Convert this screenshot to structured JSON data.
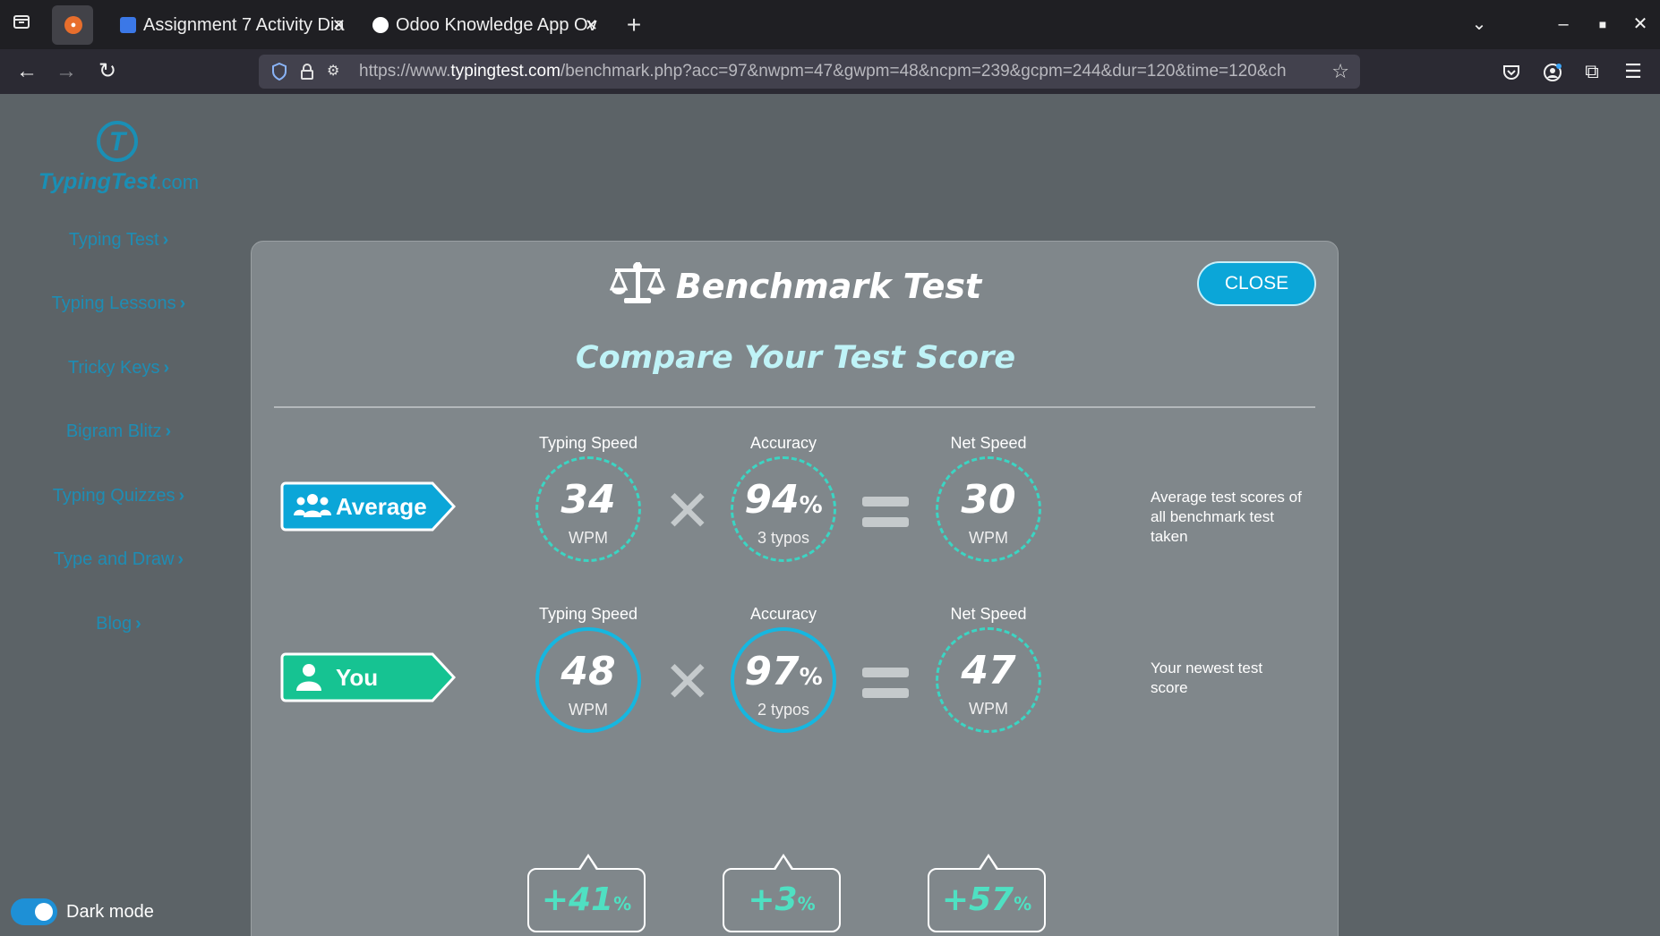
{
  "browser": {
    "tabs": [
      {
        "title": "Assignment 7 Activity Dia"
      },
      {
        "title": "Odoo Knowledge App Ov"
      }
    ],
    "url_prefix": "https://www.",
    "url_host": "typingtest.com",
    "url_rest": "/benchmark.php?acc=97&nwpm=47&gwpm=48&ncpm=239&gcpm=244&dur=120&time=120&ch"
  },
  "sidebar": {
    "logo_main": "TypingTest",
    "logo_suffix": ".com",
    "links": [
      "Typing Test",
      "Typing Lessons",
      "Tricky Keys",
      "Bigram Blitz",
      "Typing Quizzes",
      "Type and Draw",
      "Blog"
    ],
    "dark_mode_label": "Dark mode",
    "dark_mode_on": true
  },
  "modal": {
    "title": "Benchmark Test",
    "close_label": "CLOSE",
    "subtitle": "Compare Your Test Score",
    "rows": [
      {
        "tag": "Average",
        "typing_speed_label": "Typing Speed",
        "typing_speed": "34",
        "typing_speed_unit": "WPM",
        "accuracy_label": "Accuracy",
        "accuracy": "94",
        "accuracy_unit": "%",
        "typos": "3 typos",
        "net_speed_label": "Net Speed",
        "net_speed": "30",
        "net_speed_unit": "WPM",
        "note": "Average test scores of all benchmark test taken"
      },
      {
        "tag": "You",
        "typing_speed_label": "Typing Speed",
        "typing_speed": "48",
        "typing_speed_unit": "WPM",
        "accuracy_label": "Accuracy",
        "accuracy": "97",
        "accuracy_unit": "%",
        "typos": "2 typos",
        "net_speed_label": "Net Speed",
        "net_speed": "47",
        "net_speed_unit": "WPM",
        "note": "Your newest test score"
      }
    ],
    "deltas": [
      {
        "value": "+41",
        "unit": "%"
      },
      {
        "value": "+3",
        "unit": "%"
      },
      {
        "value": "+57",
        "unit": "%"
      }
    ]
  },
  "colors": {
    "average_tag": "#0ba6d8",
    "you_tag": "#16c392",
    "dashed_ring": "#3bd5c3",
    "solid_ring": "#16b7e0",
    "delta_text": "#4fe0c2"
  }
}
